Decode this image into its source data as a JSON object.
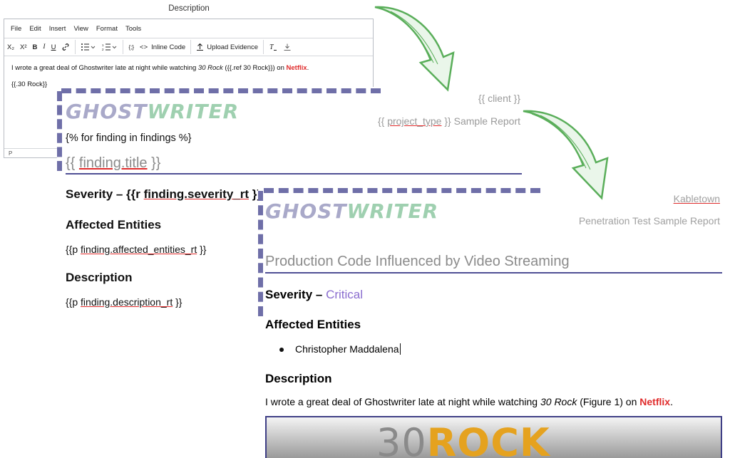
{
  "editor": {
    "title": "Description",
    "menu": [
      "File",
      "Edit",
      "Insert",
      "View",
      "Format",
      "Tools"
    ],
    "toolbar": {
      "subscript": "X₂",
      "superscript": "X²",
      "bold": "B",
      "italic": "I",
      "underline": "U",
      "link_icon": "link-icon",
      "bullet_list_icon": "bullet-list-icon",
      "numbered_list_icon": "numbered-list-icon",
      "code_button": "{;}",
      "inline_code": "Inline Code",
      "upload_evidence": "Upload Evidence",
      "clear_format_icon": "clear-format-icon",
      "download_icon": "download-icon"
    },
    "body": {
      "text1": "I wrote a great deal of Ghostwriter late at night while watching ",
      "italic": "30 Rock",
      "text2": " ({{.ref 30 Rock}}) on ",
      "netflix": "Netflix",
      "text3": ".",
      "line2": "{{.30 Rock}}"
    },
    "status": "P"
  },
  "template": {
    "logo_a": "GHOST",
    "logo_b": "WRITER",
    "client": "{{ client }}",
    "project_type_open": "{{ ",
    "project_type_var": "project_type",
    "project_type_close": " }} Sample Report",
    "loop": "{% for finding in findings %}",
    "finding_title_open": "{{ ",
    "finding_title_var": "finding.title",
    "finding_title_close": " }}",
    "severity_label": "Severity – {{r ",
    "severity_var": "finding.severity_rt",
    "severity_close": " }}",
    "affected_heading": "Affected Entities",
    "affected_open": "{{p ",
    "affected_var": "finding.affected_entities_rt",
    "affected_close": " }}",
    "description_heading": "Description",
    "description_open": "{{p ",
    "description_var": "finding.description_rt",
    "description_close": " }}"
  },
  "report": {
    "logo_a": "GHOST",
    "logo_b": "WRITER",
    "client": "Kabletown",
    "report_type": "Penetration Test Sample Report",
    "finding_title": "Production Code Influenced by Video Streaming",
    "severity_label": "Severity – ",
    "severity_value": "Critical",
    "affected_heading": "Affected Entities",
    "entity": "Christopher  Maddalena",
    "description_heading": "Description",
    "desc_text1": "I wrote a great deal of Ghostwriter late at night while watching ",
    "desc_italic": "30 Rock",
    "desc_text2": " (Figure 1) on ",
    "desc_netflix": "Netflix",
    "desc_text3": ".",
    "image_logo_a": "30",
    "image_logo_b": "ROCK"
  },
  "colors": {
    "accent_purple": "#4f4f95",
    "dash": "#6f6fa8",
    "netflix_red": "#e02b2b",
    "critical": "#8a6dcf",
    "arrow_green": "#5aae5a"
  }
}
